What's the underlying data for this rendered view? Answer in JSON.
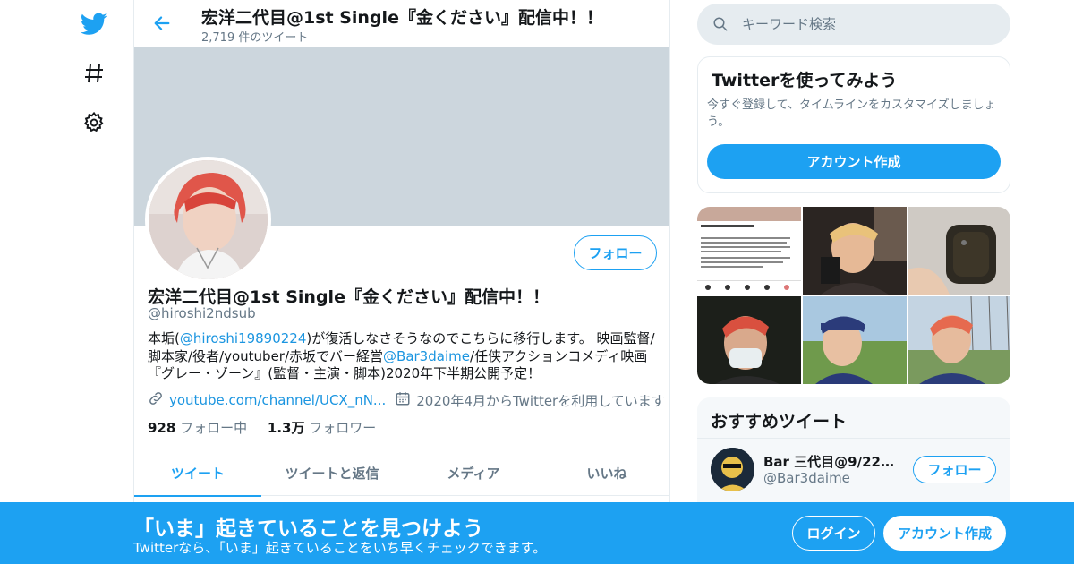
{
  "header": {
    "title": "宏洋二代目@1st Single『金ください』配信中！！",
    "tweet_count": "2,719 件のツイート"
  },
  "nav": {
    "icons": [
      "twitter-bird-icon",
      "hashtag-icon",
      "settings-gear-icon"
    ]
  },
  "profile": {
    "name": "宏洋二代目@1st Single『金ください』配信中！！",
    "handle": "@hiroshi2ndsub",
    "follow_label": "フォロー",
    "bio": {
      "part1": "本垢(",
      "mention1": "@hiroshi19890224",
      "part2": ")が復活しなさそうなのでこちらに移行します。 映画監督/脚本家/役者/youtuber/赤坂でバー経営",
      "mention2": "@Bar3daime",
      "part3": "/任侠アクションコメディ映画『グレー・ゾーン』(監督・主演・脚本)2020年下半期公開予定！"
    },
    "url": "youtube.com/channel/UCX_nN...",
    "joined": "2020年4月からTwitterを利用しています",
    "following_count": "928",
    "following_label": "フォロー中",
    "followers_count": "1.3万",
    "followers_label": "フォロワー"
  },
  "tabs": [
    {
      "label": "ツイート",
      "active": true
    },
    {
      "label": "ツイートと返信",
      "active": false
    },
    {
      "label": "メディア",
      "active": false
    },
    {
      "label": "いいね",
      "active": false
    }
  ],
  "search": {
    "placeholder": "キーワード検索"
  },
  "signup_card": {
    "title": "Twitterを使ってみよう",
    "description": "今すぐ登録して、タイムラインをカスタマイズしましょう。",
    "button_label": "アカウント作成"
  },
  "recommended": {
    "title": "おすすめツイート",
    "name": "Bar 三代目@9/22東...",
    "handle": "@Bar3daime",
    "follow_label": "フォロー"
  },
  "bottom_bar": {
    "title": "「いま」起きていることを見つけよう",
    "subtitle": "Twitterなら、「いま」起きていることをいち早くチェックできます。",
    "login_label": "ログイン",
    "signup_label": "アカウント作成"
  },
  "colors": {
    "accent": "#1da1f2",
    "link": "#1b95e0",
    "banner": "#ccd6dd",
    "secondary_text": "#657786"
  }
}
